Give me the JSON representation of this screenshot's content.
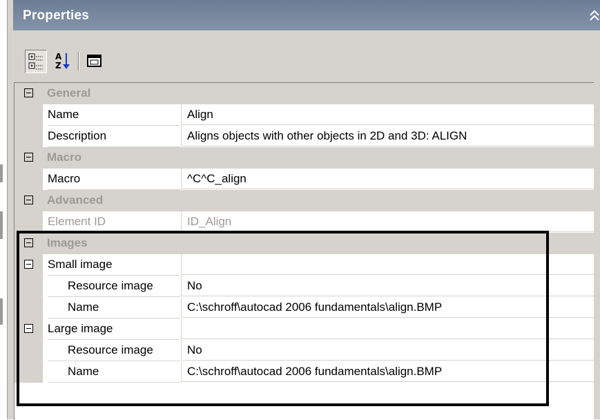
{
  "panel": {
    "title": "Properties",
    "collapse_icon": "double-chevron-up-icon"
  },
  "toolbar": {
    "buttons": [
      {
        "name": "categorized-view",
        "icon": "categorized-icon",
        "pressed": true
      },
      {
        "name": "alphabetical-sort",
        "icon": "sort-az-icon",
        "pressed": false
      },
      {
        "name": "property-pages",
        "icon": "property-pages-icon",
        "pressed": false
      }
    ]
  },
  "grid": {
    "general": {
      "label": "General",
      "name": {
        "label": "Name",
        "value": "Align"
      },
      "description": {
        "label": "Description",
        "value": "Aligns objects with other objects in 2D and 3D:  ALIGN"
      }
    },
    "macro": {
      "label": "Macro",
      "macro": {
        "label": "Macro",
        "value": "^C^C_align"
      }
    },
    "advanced": {
      "label": "Advanced",
      "element_id": {
        "label": "Element ID",
        "value": "ID_Align"
      }
    },
    "images": {
      "label": "Images",
      "small_image": {
        "label": "Small image",
        "resource": {
          "label": "Resource image",
          "value": "No"
        },
        "name": {
          "label": "Name",
          "value": "C:\\schroff\\autocad 2006 fundamentals\\align.BMP"
        }
      },
      "large_image": {
        "label": "Large image",
        "resource": {
          "label": "Resource image",
          "value": "No"
        },
        "name": {
          "label": "Name",
          "value": "C:\\schroff\\autocad 2006 fundamentals\\align.BMP"
        }
      }
    }
  },
  "colors": {
    "titlebar": "#7584a0",
    "panel_bg": "#d6d3ce",
    "category_text": "#9d9a95"
  }
}
